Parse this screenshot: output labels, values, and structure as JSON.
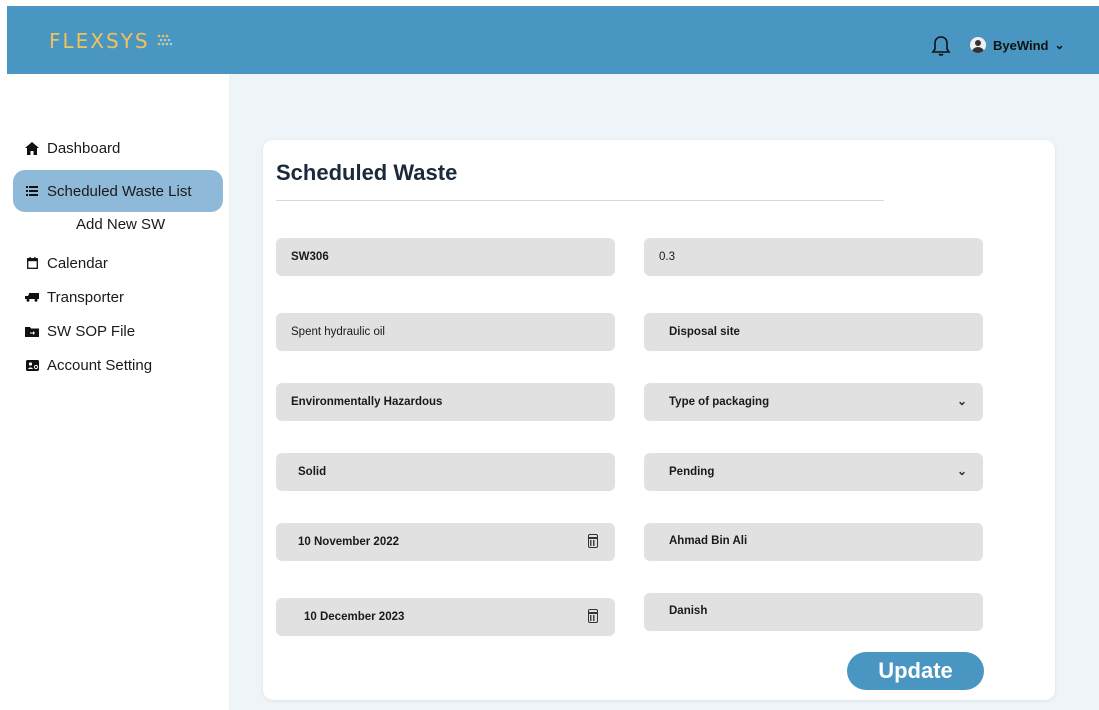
{
  "header": {
    "logo": "FLEXSYS",
    "user_name": "ByeWind",
    "accent": "#4a96c2"
  },
  "sidebar": {
    "items": [
      {
        "label": "Dashboard",
        "icon": "home-icon"
      },
      {
        "label": "Scheduled Waste List",
        "icon": "list-icon"
      },
      {
        "label": "Calendar",
        "icon": "calendar-icon"
      },
      {
        "label": "Transporter",
        "icon": "truck-icon"
      },
      {
        "label": "SW SOP File",
        "icon": "folder-icon"
      },
      {
        "label": "Account Setting",
        "icon": "account-icon"
      }
    ],
    "sub_item": "Add New SW"
  },
  "form": {
    "title": "Scheduled Waste",
    "fields": {
      "code": "SW306",
      "quantity": "0.3",
      "waste_name": "Spent hydraulic oil",
      "disposal_site": "Disposal site",
      "category": "Environmentally Hazardous",
      "packaging": "Type of packaging",
      "state": "Solid",
      "status": "Pending",
      "date_1": "10 November 2022",
      "person_1": "Ahmad Bin Ali",
      "date_2": "10 December 2023",
      "person_2": "Danish"
    },
    "update_label": "Update"
  }
}
